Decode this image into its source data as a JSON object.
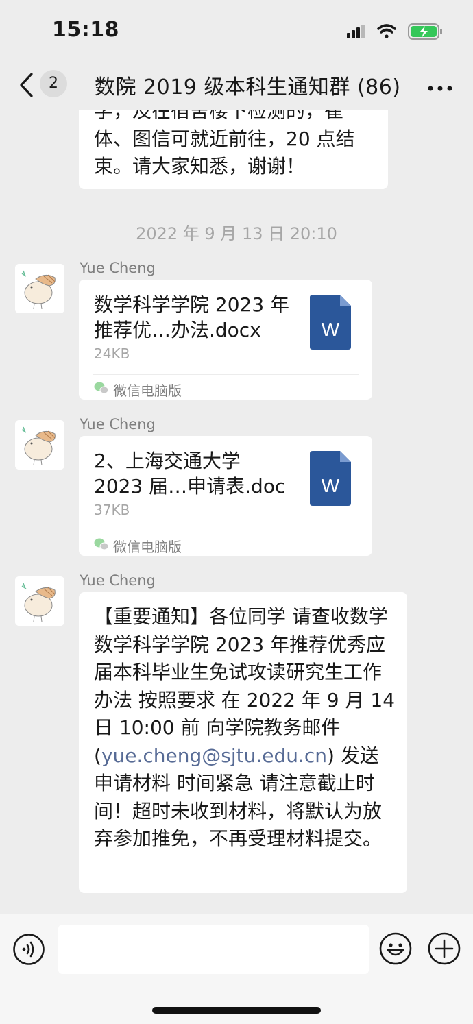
{
  "status_bar": {
    "time": "15:18"
  },
  "nav": {
    "unread_count": "2",
    "title": "数院 2019 级本科生通知群 (86)"
  },
  "chat": {
    "prev_message": "学，及在宿舍楼下检测的，崔体、图信可就近前往，20 点结束。请大家知悉，谢谢！",
    "timestamp": "2022 年 9 月 13 日 20:10",
    "messages": [
      {
        "sender": "Yue Cheng",
        "file_name": "数学科学学院 2023 年推荐优…办法.docx",
        "file_size": "24KB",
        "source": "微信电脑版",
        "file_icon": "word-doc-icon"
      },
      {
        "sender": "Yue Cheng",
        "file_name": "2、上海交通大学 2023 届…申请表.doc",
        "file_size": "37KB",
        "source": "微信电脑版",
        "file_icon": "word-doc-icon"
      },
      {
        "sender": "Yue Cheng",
        "text_before": "【重要通知】各位同学 请查收数学数学科学学院 2023 年推荐优秀应届本科毕业生免试攻读研究生工作办法 按照要求 在 2022 年 9 月 14 日 10:00 前 向学院教务邮件 (",
        "email": "yue.cheng@sjtu.edu.cn",
        "text_after": ") 发送申请材料 时间紧急 请注意截止时间！超时未收到材料，将默认为放弃参加推免，不再受理材料提交。"
      }
    ]
  },
  "colors": {
    "background": "#ededed",
    "bubble": "#ffffff",
    "link": "#576b95",
    "word_blue": "#2b579a",
    "battery_green": "#34c759"
  }
}
